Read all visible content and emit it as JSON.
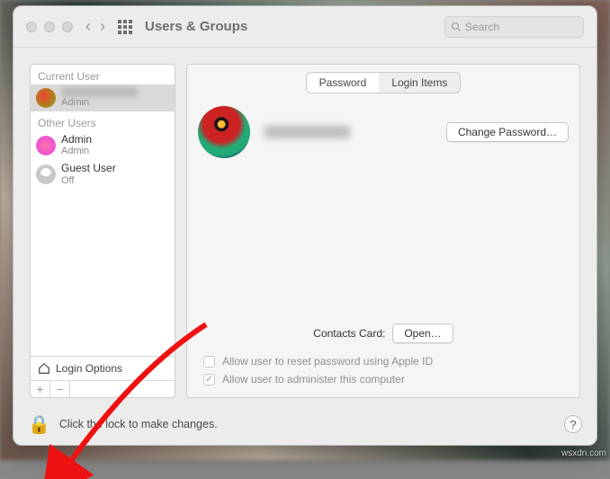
{
  "window": {
    "title": "Users & Groups"
  },
  "search": {
    "placeholder": "Search"
  },
  "sidebar": {
    "current_label": "Current User",
    "other_label": "Other Users",
    "users": [
      {
        "name": "",
        "role": "Admin"
      },
      {
        "name": "Admin",
        "role": "Admin"
      },
      {
        "name": "Guest User",
        "role": "Off"
      }
    ],
    "login_options": "Login Options"
  },
  "tabs": {
    "password": "Password",
    "login_items": "Login Items"
  },
  "main": {
    "change_password": "Change Password…",
    "contacts_label": "Contacts Card:",
    "open_btn": "Open…",
    "reset_pw": "Allow user to reset password using Apple ID",
    "admin_check": "Allow user to administer this computer"
  },
  "footer": {
    "lock_text": "Click the lock to make changes.",
    "help": "?"
  },
  "watermark": "wsxdn.com"
}
